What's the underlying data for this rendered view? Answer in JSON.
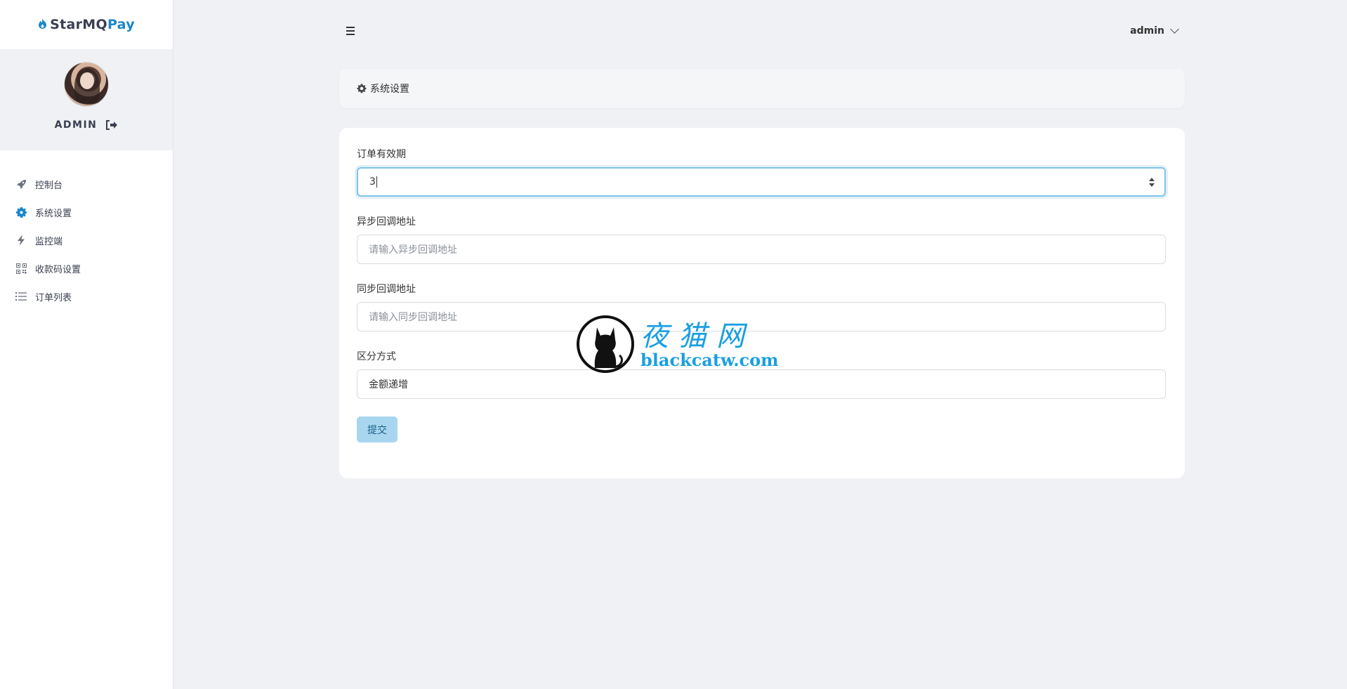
{
  "brand": {
    "part1": "StarMQ",
    "part2": "Pay"
  },
  "profile": {
    "name": "ADMIN"
  },
  "sidebar": {
    "items": [
      {
        "label": "控制台",
        "icon": "rocket-icon",
        "active": false
      },
      {
        "label": "系统设置",
        "icon": "gear-icon",
        "active": true
      },
      {
        "label": "监控端",
        "icon": "bolt-icon",
        "active": false
      },
      {
        "label": "收款码设置",
        "icon": "qrcode-icon",
        "active": false
      },
      {
        "label": "订单列表",
        "icon": "list-icon",
        "active": false
      }
    ]
  },
  "header": {
    "user": "admin"
  },
  "breadcrumb": {
    "title": "系统设置"
  },
  "form": {
    "order_expiry": {
      "label": "订单有效期",
      "value": "3"
    },
    "async_callback": {
      "label": "异步回调地址",
      "placeholder": "请输入异步回调地址"
    },
    "sync_callback": {
      "label": "同步回调地址",
      "placeholder": "请输入同步回调地址"
    },
    "distinguish": {
      "label": "区分方式",
      "value": "金额递增"
    },
    "submit_label": "提交"
  },
  "watermark": {
    "line1": "夜猫网",
    "line2": "blackcatw.com"
  },
  "colors": {
    "accent": "#1b86c8",
    "focus": "#7ec4ea",
    "button": "#a9d6ef",
    "watermark": "#1b9fe0",
    "background": "#f0f1f4"
  }
}
